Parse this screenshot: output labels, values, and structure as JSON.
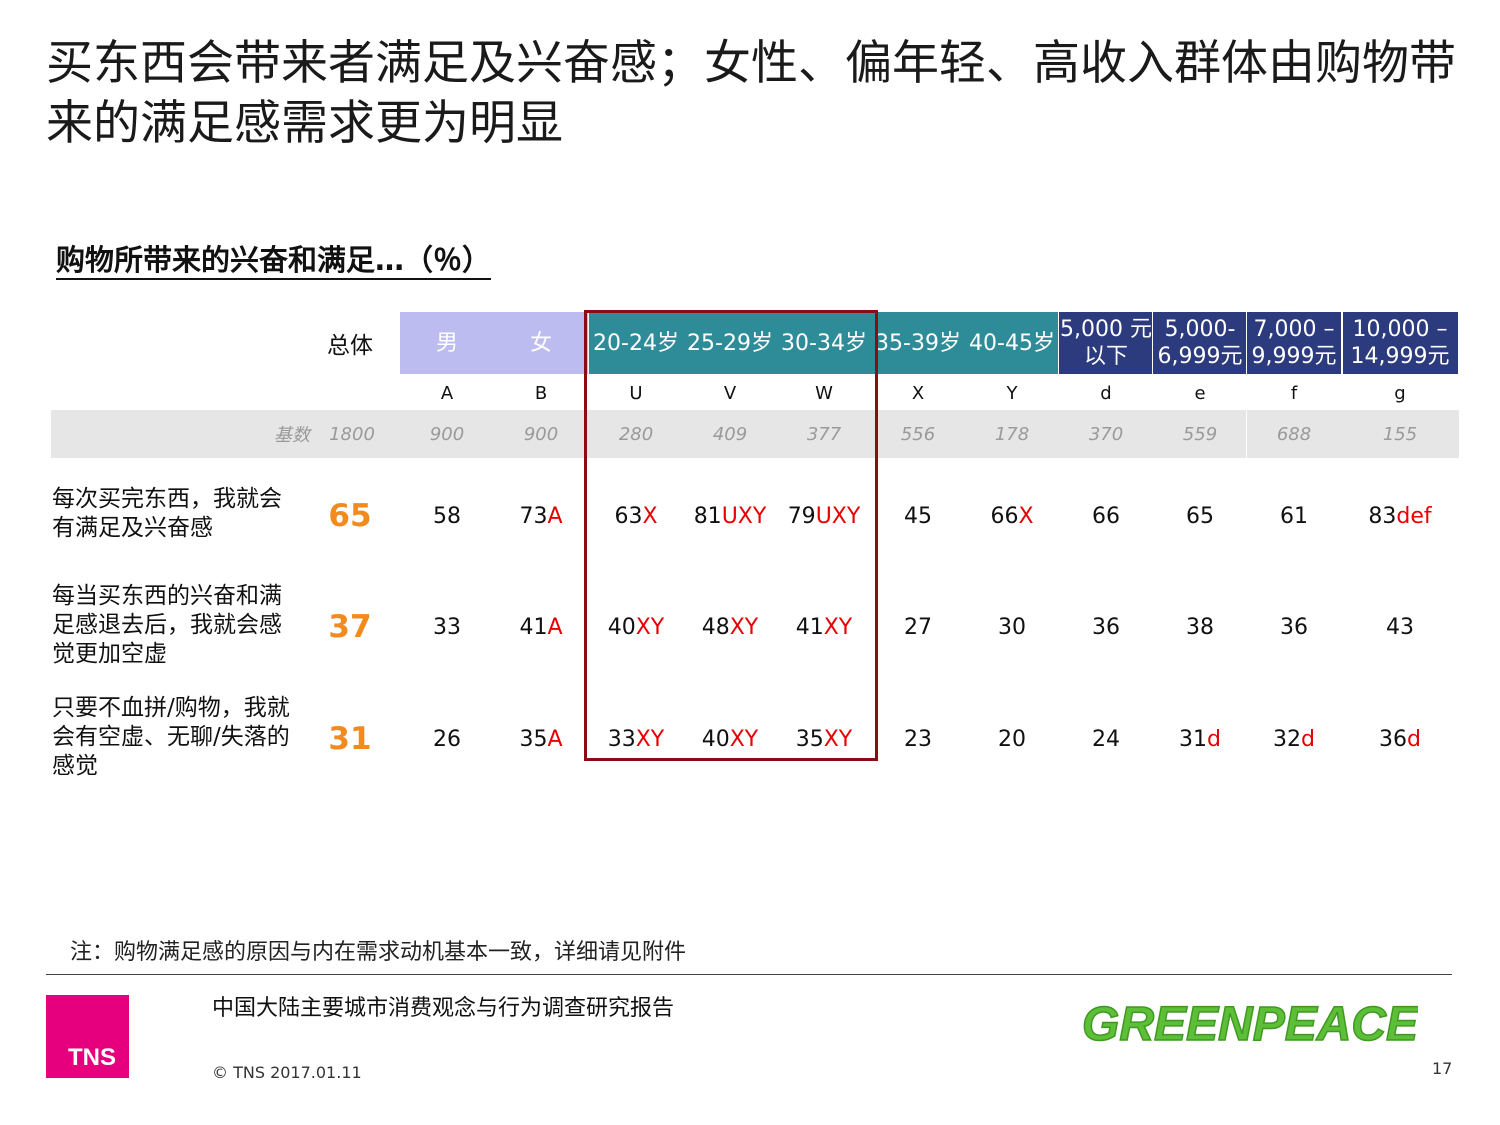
{
  "title": "买东西会带来者满足及兴奋感；女性、偏年轻、高收入群体由购物带来的满足感需求更为明显",
  "subtitle": "购物所带来的兴奋和满足…（％）",
  "table": {
    "total_header": "总体",
    "base_label": "基数",
    "base_total": "1800",
    "columns": [
      {
        "header": "男",
        "letter": "A",
        "base": "900",
        "color": "#bcbcf0"
      },
      {
        "header": "女",
        "letter": "B",
        "base": "900",
        "color": "#bcbcf0"
      },
      {
        "header": "20-24岁",
        "letter": "U",
        "base": "280",
        "color": "#2e8b98"
      },
      {
        "header": "25-29岁",
        "letter": "V",
        "base": "409",
        "color": "#2e8b98"
      },
      {
        "header": "30-34岁",
        "letter": "W",
        "base": "377",
        "color": "#2e8b98"
      },
      {
        "header": "35-39岁",
        "letter": "X",
        "base": "556",
        "color": "#2e8b98"
      },
      {
        "header": "40-45岁",
        "letter": "Y",
        "base": "178",
        "color": "#2e8b98"
      },
      {
        "header": "5,000 元\n以下",
        "letter": "d",
        "base": "370",
        "color": "#2c3a7e"
      },
      {
        "header": "5,000-\n6,999元",
        "letter": "e",
        "base": "559",
        "color": "#2c3a7e"
      },
      {
        "header": "7,000 –\n9,999元",
        "letter": "f",
        "base": "688",
        "color": "#2c3a7e"
      },
      {
        "header": "10,000 –\n14,999元",
        "letter": "g",
        "base": "155",
        "color": "#2c3a7e"
      }
    ],
    "rows": [
      {
        "label": "每次买完东西，我就会有满足及兴奋感",
        "total": "65",
        "cells": [
          {
            "value": "58",
            "sig": ""
          },
          {
            "value": "73",
            "sig": "A"
          },
          {
            "value": "63",
            "sig": "X"
          },
          {
            "value": "81",
            "sig": "UXY"
          },
          {
            "value": "79",
            "sig": "UXY"
          },
          {
            "value": "45",
            "sig": ""
          },
          {
            "value": "66",
            "sig": "X"
          },
          {
            "value": "66",
            "sig": ""
          },
          {
            "value": "65",
            "sig": ""
          },
          {
            "value": "61",
            "sig": ""
          },
          {
            "value": "83",
            "sig": "def"
          }
        ]
      },
      {
        "label": "每当买东西的兴奋和满足感退去后，我就会感觉更加空虚",
        "total": "37",
        "cells": [
          {
            "value": "33",
            "sig": ""
          },
          {
            "value": "41",
            "sig": "A"
          },
          {
            "value": "40",
            "sig": "XY"
          },
          {
            "value": "48",
            "sig": "XY"
          },
          {
            "value": "41",
            "sig": "XY"
          },
          {
            "value": "27",
            "sig": ""
          },
          {
            "value": "30",
            "sig": ""
          },
          {
            "value": "36",
            "sig": ""
          },
          {
            "value": "38",
            "sig": ""
          },
          {
            "value": "36",
            "sig": ""
          },
          {
            "value": "43",
            "sig": ""
          }
        ]
      },
      {
        "label": "只要不血拼/购物，我就会有空虚、无聊/失落的感觉",
        "total": "31",
        "cells": [
          {
            "value": "26",
            "sig": ""
          },
          {
            "value": "35",
            "sig": "A"
          },
          {
            "value": "33",
            "sig": "XY"
          },
          {
            "value": "40",
            "sig": "XY"
          },
          {
            "value": "35",
            "sig": "XY"
          },
          {
            "value": "23",
            "sig": ""
          },
          {
            "value": "20",
            "sig": ""
          },
          {
            "value": "24",
            "sig": ""
          },
          {
            "value": "31",
            "sig": "d"
          },
          {
            "value": "32",
            "sig": "d"
          },
          {
            "value": "36",
            "sig": "d"
          }
        ]
      }
    ]
  },
  "note": "注：购物满足感的原因与内在需求动机基本一致，详细请见附件",
  "footer": {
    "report_title": "中国大陆主要城市消费观念与行为调查研究报告",
    "copyright": "© TNS 2017.01.11",
    "page_number": "17",
    "tns_logo": "TNS",
    "greenpeace_logo": "GREENPEACE"
  }
}
